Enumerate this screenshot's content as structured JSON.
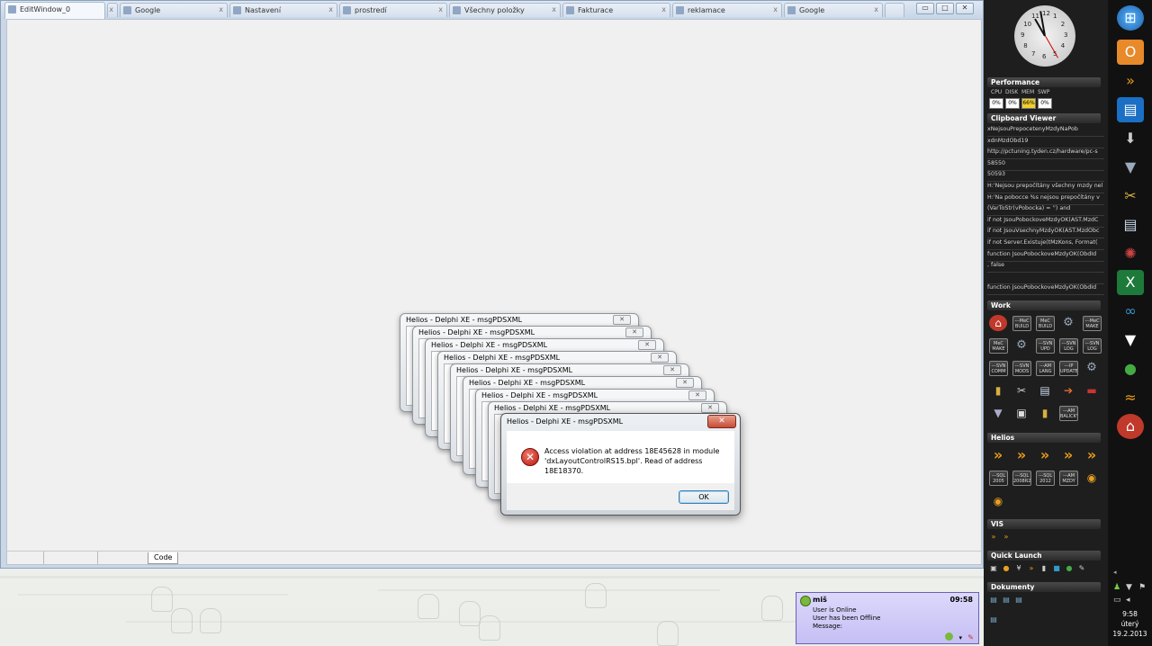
{
  "edit_window": {
    "tabs": [
      {
        "label": "EditWindow_0",
        "active": true
      },
      {
        "label": "",
        "active": false
      },
      {
        "label": "Google",
        "active": false
      },
      {
        "label": "Nastavení",
        "active": false
      },
      {
        "label": "prostredí",
        "active": false
      },
      {
        "label": "Všechny položky",
        "active": false
      },
      {
        "label": "Fakturace",
        "active": false
      },
      {
        "label": "reklamace",
        "active": false
      },
      {
        "label": "Google",
        "active": false
      }
    ],
    "controls": {
      "minimize": "▭",
      "maximize": "□",
      "close": "✕"
    },
    "status_tab": "Code"
  },
  "dialog_stack": {
    "title": "Helios - Delphi XE - msgPDSXML",
    "count": 8
  },
  "error_dialog": {
    "title": "Helios - Delphi XE - msgPDSXML",
    "close": "✕",
    "icon": "error-icon",
    "message": "Access violation at address 18E45628 in module 'dxLayoutControlRS15.bpl'. Read of address 18E18370.",
    "ok_label": "OK"
  },
  "sidebar": {
    "clock_numbers": [
      "12",
      "1",
      "2",
      "3",
      "4",
      "5",
      "6",
      "7",
      "8",
      "9",
      "10",
      "11"
    ],
    "performance": {
      "title": "Performance",
      "labels": [
        "CPU",
        "DISK",
        "MEM",
        "SWP"
      ],
      "values": [
        "0%",
        "0%",
        "66%",
        "0%"
      ]
    },
    "clipboard": {
      "title": "Clipboard Viewer",
      "items": [
        "xNejsouPrepocetenyMzdyNaPob",
        "xdnMzdObd19",
        "http://pctuning.tyden.cz/hardware/pc-s",
        "58550",
        "50593",
        "H:'Nejsou prepočítány všechny mzdy nel",
        "H:'Na pobocce %s nejsou prepočítány v",
        "(VarToStr(vPobocka) = '') and",
        "if not JsouPobockoveMzdyOK(AST.MzdC",
        "if not JsouVsechnyMzdyOK(AST.MzdObc",
        "if not Server.Existuje(tMzKons, Format(",
        "function JsouPobockoveMzdyOK(ObdId",
        ", false",
        "",
        "function JsouPobockoveMzdyOK(ObdId"
      ]
    },
    "work": {
      "title": "Work",
      "icons": [
        "---MeC\nBUILD",
        "MeC\nBUILD",
        "",
        "---MeC\nMAKE",
        "MeC\nMAKE",
        "",
        "---SVN\nUPD",
        "---SVN\nLOG",
        "---SVN\nLOG",
        "---SVN\nCOMM",
        "---SVN\nMODS",
        "---AM\nLANG",
        "---IP\nUPDATE",
        "---AM\nBALICKY"
      ]
    },
    "helios": {
      "title": "Helios",
      "icons": [
        "---SQL\n2005",
        "---SQL\n2008R2",
        "---SQL\n2012",
        "---AM\nMZDY"
      ]
    },
    "vis": {
      "title": "VIS"
    },
    "quick_launch": {
      "title": "Quick Launch"
    },
    "dokumenty": {
      "title": "Dokumenty"
    }
  },
  "tray": {
    "time": "9:58",
    "day": "úterý",
    "date": "19.2.2013"
  },
  "notification": {
    "user": "miš",
    "time": "09:58",
    "lines": [
      "User is Online",
      "User has been Offline",
      "Message:"
    ]
  }
}
